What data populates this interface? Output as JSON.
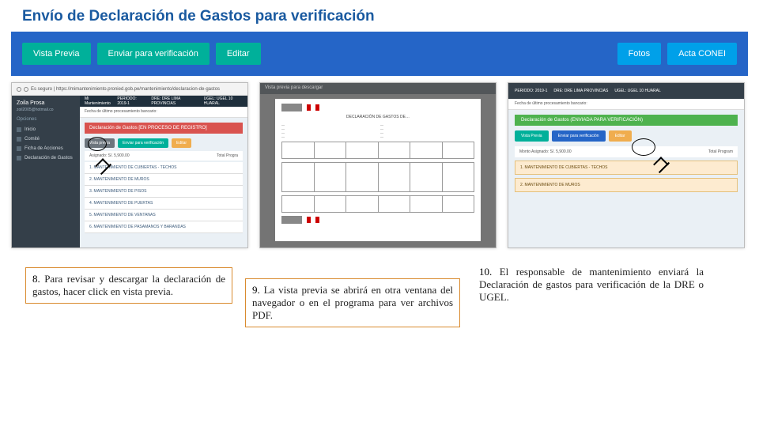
{
  "title": "Envío de Declaración de Gastos para verificación",
  "topbar": {
    "status_label": "Declaración de Gastos [EN PROCESO DE REGISTRO]",
    "vista_previa": "Vista Previa",
    "enviar": "Enviar para verificación",
    "editar": "Editar",
    "fotos": "Fotos",
    "acta": "Acta CONEI"
  },
  "shot1": {
    "url": "Es seguro | https://mimantenimiento.pronied.gob.pe/mantenimiento/declaracion-de-gastos",
    "app_name": "Mi Mantenimiento",
    "period": "PERIODO: 2019-1",
    "dre": "DRE: DRE LIMA PROVINCIAS",
    "ugel": "UGEL: UGEL 10 HUARAL",
    "sub": "Fecha de último procesamiento bancario:",
    "status": "Declaración de Gastos [EN PROCESO DE REGISTRO]",
    "btn_prev": "Vista previa",
    "btn_env": "Enviar para verificación",
    "btn_ed": "Editar",
    "monto": "Asignado: S/. 5,900.00",
    "total": "Total Progra",
    "user_name": "Zoila Prosa",
    "user_mail": "zoil2005@hotmail.co",
    "opciones": "Opciones",
    "side": [
      "Inicio",
      "Comité",
      "Ficha de Acciones",
      "Declaración de Gastos"
    ],
    "list": [
      "1. MANTENIMIENTO DE CUBIERTAS - TECHOS",
      "2. MANTENIMIENTO DE MUROS",
      "3. MANTENIMIENTO DE PISOS",
      "4. MANTENIMIENTO DE PUERTAS",
      "5. MANTENIMIENTO DE VENTANAS",
      "6. MANTENIMIENTO DE PASAMANOS Y BARANDAS"
    ]
  },
  "shot2": {
    "bar": "Vista previa para descargar",
    "logo": "PRONIED",
    "doc_title": "DECLARACIÓN DE GASTOS DE…",
    "foot_logo": "PRONIED"
  },
  "shot3": {
    "period": "PERIODO: 2019-1",
    "dre": "DRE: DRE LIMA PROVINCIAS",
    "ugel": "UGEL: UGEL 10 HUARAL",
    "sub": "Fecha de último procesamiento bancario:",
    "status": "Declaración de Gastos (ENVIADA PARA VERIFICACIÓN)",
    "btn_prev": "Vista Previa",
    "btn_env": "Enviar para verificación",
    "btn_ed": "Editar",
    "monto": "Monto Asignado: S/. 5,900.00",
    "total": "Total Program",
    "list": [
      "1. MANTENIMIENTO DE CUBIERTAS - TECHOS",
      "2. MANTENIMIENTO DE MUROS"
    ]
  },
  "captions": {
    "c1_num": "8.",
    "c1": " Para revisar y descargar la declaración de gastos, hacer click en vista previa.",
    "c2_num": "9.",
    "c2": " La vista previa se abrirá en otra ventana del navegador o en el programa para ver archivos PDF.",
    "c3_num": "10.",
    "c3": " El responsable de mantenimiento enviará la Declaración de gastos para verificación de la DRE o UGEL."
  }
}
